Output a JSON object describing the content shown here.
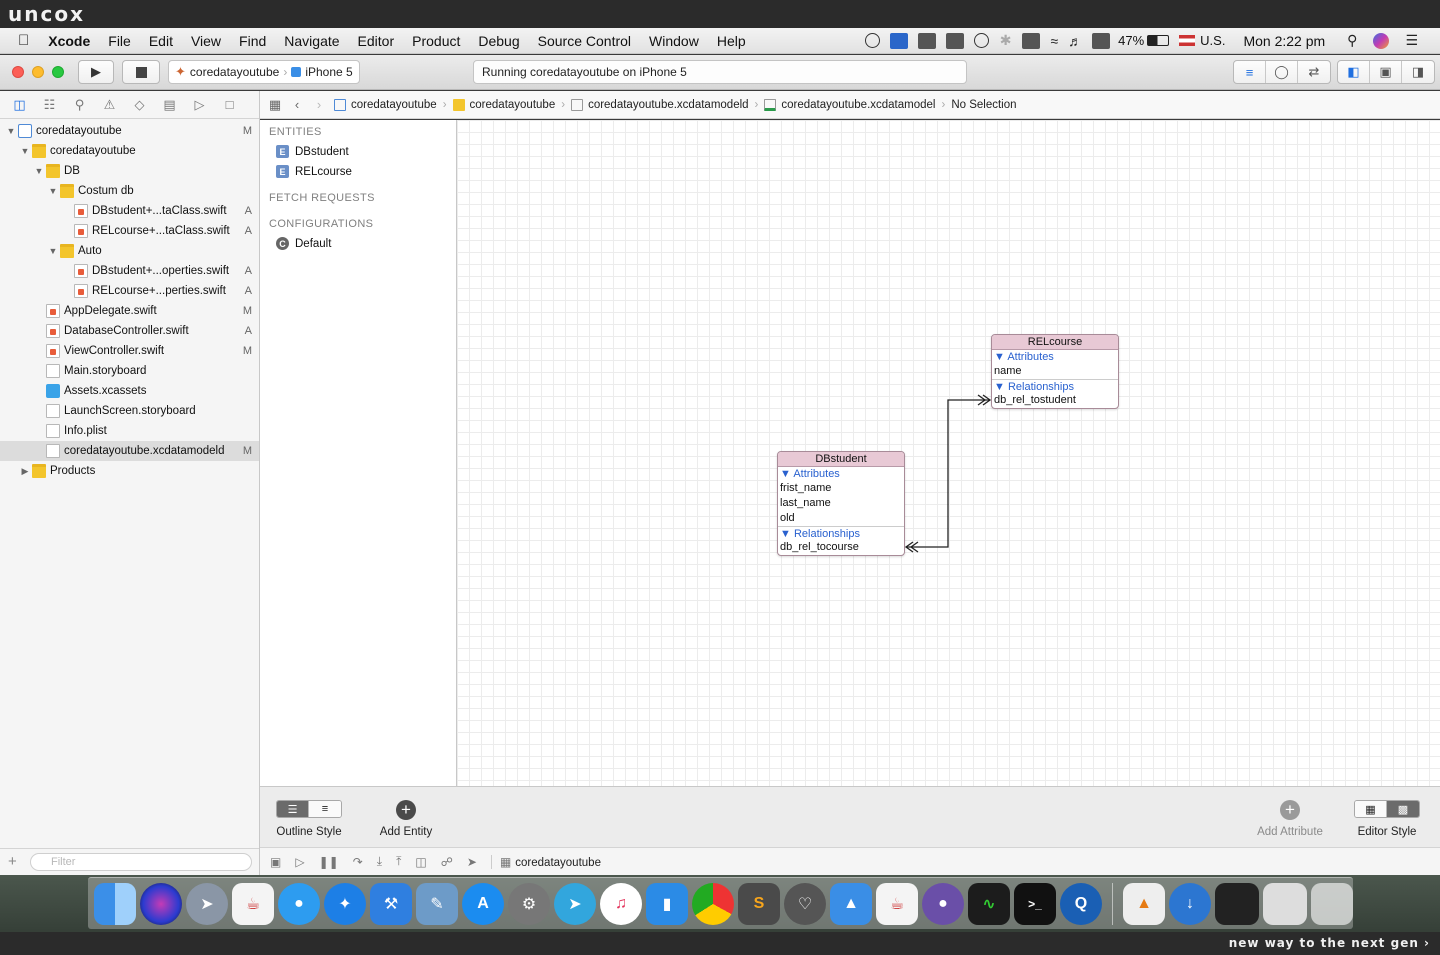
{
  "watermark": {
    "logo": "uncox",
    "tagline": "new way to the next gen ›"
  },
  "menubar": {
    "apple": "",
    "app": "Xcode",
    "items": [
      "File",
      "Edit",
      "View",
      "Find",
      "Navigate",
      "Editor",
      "Product",
      "Debug",
      "Source Control",
      "Window",
      "Help"
    ],
    "battery": "47%",
    "input_source": "U.S.",
    "clock": "Mon 2:22 pm"
  },
  "toolbar": {
    "scheme": "coredatayoutube",
    "device": "iPhone 5",
    "activity": "Running coredatayoutube on iPhone 5"
  },
  "navigator": {
    "tree": [
      {
        "label": "coredatayoutube",
        "status": "M",
        "depth": 0,
        "type": "proj",
        "open": true
      },
      {
        "label": "coredatayoutube",
        "status": "",
        "depth": 1,
        "type": "folder",
        "open": true
      },
      {
        "label": "DB",
        "status": "",
        "depth": 2,
        "type": "folder",
        "open": true
      },
      {
        "label": "Costum db",
        "status": "",
        "depth": 3,
        "type": "folder",
        "open": true
      },
      {
        "label": "DBstudent+...taClass.swift",
        "status": "A",
        "depth": 4,
        "type": "swift"
      },
      {
        "label": "RELcourse+...taClass.swift",
        "status": "A",
        "depth": 4,
        "type": "swift"
      },
      {
        "label": "Auto",
        "status": "",
        "depth": 3,
        "type": "folder",
        "open": true
      },
      {
        "label": "DBstudent+...operties.swift",
        "status": "A",
        "depth": 4,
        "type": "swift"
      },
      {
        "label": "RELcourse+...perties.swift",
        "status": "A",
        "depth": 4,
        "type": "swift"
      },
      {
        "label": "AppDelegate.swift",
        "status": "M",
        "depth": 2,
        "type": "swift"
      },
      {
        "label": "DatabaseController.swift",
        "status": "A",
        "depth": 2,
        "type": "swift"
      },
      {
        "label": "ViewController.swift",
        "status": "M",
        "depth": 2,
        "type": "swift"
      },
      {
        "label": "Main.storyboard",
        "status": "",
        "depth": 2,
        "type": "file"
      },
      {
        "label": "Assets.xcassets",
        "status": "",
        "depth": 2,
        "type": "blue"
      },
      {
        "label": "LaunchScreen.storyboard",
        "status": "",
        "depth": 2,
        "type": "file"
      },
      {
        "label": "Info.plist",
        "status": "",
        "depth": 2,
        "type": "file"
      },
      {
        "label": "coredatayoutube.xcdatamodeld",
        "status": "M",
        "depth": 2,
        "type": "file",
        "selected": true
      },
      {
        "label": "Products",
        "status": "",
        "depth": 1,
        "type": "folder",
        "open": false
      }
    ],
    "filter_placeholder": "Filter"
  },
  "jumpbar": {
    "crumbs": [
      "coredatayoutube",
      "coredatayoutube",
      "coredatayoutube.xcdatamodeld",
      "coredatayoutube.xcdatamodel",
      "No Selection"
    ]
  },
  "outline": {
    "entities_header": "ENTITIES",
    "entities": [
      "DBstudent",
      "RELcourse"
    ],
    "fetch_header": "FETCH REQUESTS",
    "config_header": "CONFIGURATIONS",
    "configs": [
      "Default"
    ],
    "entity_badge": "E",
    "config_badge": "C"
  },
  "diagram": {
    "entities": [
      {
        "name": "RELcourse",
        "attributes_label": "Attributes",
        "attributes": [
          "name"
        ],
        "relationships_label": "Relationships",
        "relationships": [
          "db_rel_tostudent"
        ]
      },
      {
        "name": "DBstudent",
        "attributes_label": "Attributes",
        "attributes": [
          "frist_name",
          "last_name",
          "old"
        ],
        "relationships_label": "Relationships",
        "relationships": [
          "db_rel_tocourse"
        ]
      }
    ]
  },
  "editor_bar": {
    "outline_style": "Outline Style",
    "add_entity": "Add Entity",
    "add_attribute": "Add Attribute",
    "editor_style": "Editor Style"
  },
  "debug_bar": {
    "process": "coredatayoutube"
  },
  "colors": {
    "accent": "#1f6fe0",
    "entity_header": "#e8c9d5",
    "section_blue": "#2961cf"
  }
}
